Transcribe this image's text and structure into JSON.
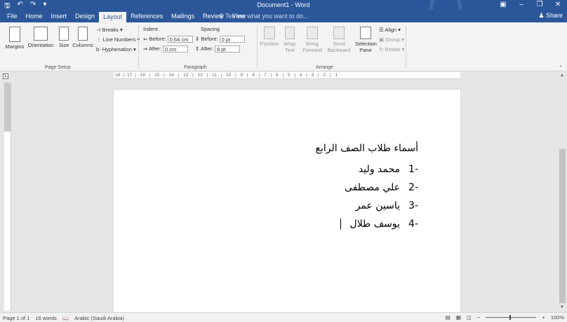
{
  "window": {
    "title": "Document1 - Word",
    "quick_access": [
      "save-icon",
      "undo-icon",
      "redo-icon",
      "customize-icon"
    ],
    "controls": [
      "ribbon-options-icon",
      "minimize-icon",
      "restore-icon",
      "close-icon"
    ]
  },
  "tabs": [
    "File",
    "Home",
    "Insert",
    "Design",
    "Layout",
    "References",
    "Mailings",
    "Review",
    "View"
  ],
  "active_tab": "Layout",
  "tell_me": "Tell me what you want to do...",
  "share_label": "Share",
  "ribbon": {
    "page_setup": {
      "label": "Page Setup",
      "margins": "Margins",
      "orientation": "Orientation",
      "size": "Size",
      "columns": "Columns",
      "breaks": "Breaks",
      "line_numbers": "Line Numbers",
      "hyphenation": "Hyphenation"
    },
    "paragraph": {
      "label": "Paragraph",
      "indent": "Indent",
      "spacing": "Spacing",
      "before_label": "Before:",
      "after_label": "After:",
      "indent_before": "0.64 cm",
      "indent_after": "0 cm",
      "spacing_before": "0 pt",
      "spacing_after": "8 pt"
    },
    "arrange": {
      "label": "Arrange",
      "position": "Position",
      "wrap_text": "Wrap Text",
      "bring_forward": "Bring Forward",
      "send_backward": "Send Backward",
      "selection_pane": "Selection Pane",
      "align": "Align",
      "group": "Group",
      "rotate": "Rotate"
    }
  },
  "ruler_text": "·18· | ·17· | · 16 · | · 15 · | · 14 · | · 13 · | · 12 · | · 11 · | · 10 · | · 9 · | · 8 · | · 7 · | · 6 · | · 5 · | · 4 · | · 3 · | · 2 · | · 1 ·",
  "document": {
    "heading": "أسماء طلاب الصف الرابع",
    "items": [
      {
        "num": "-1",
        "name": "محمد وليد"
      },
      {
        "num": "-2",
        "name": "علي مصطفى"
      },
      {
        "num": "-3",
        "name": "ياسين عمر"
      },
      {
        "num": "-4",
        "name": "يوسف طلال"
      }
    ]
  },
  "status": {
    "page": "Page 1 of 1",
    "words": "16 words",
    "language": "Arabic (Saudi Arabia)",
    "zoom": "100%"
  }
}
